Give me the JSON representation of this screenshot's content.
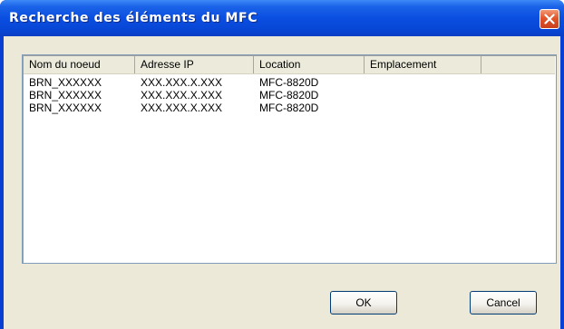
{
  "window": {
    "title": "Recherche des éléments du MFC"
  },
  "list": {
    "columns": [
      "Nom du noeud",
      "Adresse IP",
      "Location",
      "Emplacement"
    ],
    "rows": [
      [
        "BRN_XXXXXX",
        "XXX.XXX.X.XXX",
        "MFC-8820D",
        ""
      ],
      [
        "BRN_XXXXXX",
        "XXX.XXX.X.XXX",
        "MFC-8820D",
        ""
      ],
      [
        "BRN_XXXXXX",
        "XXX.XXX.X.XXX",
        "MFC-8820D",
        ""
      ]
    ]
  },
  "buttons": {
    "ok_label": "OK",
    "cancel_label": "Cancel"
  },
  "icons": {
    "close": "close-icon"
  },
  "colors": {
    "title_bar": "#0a4ee0",
    "close_button": "#e2552b",
    "dialog_face": "#ece9d8"
  }
}
